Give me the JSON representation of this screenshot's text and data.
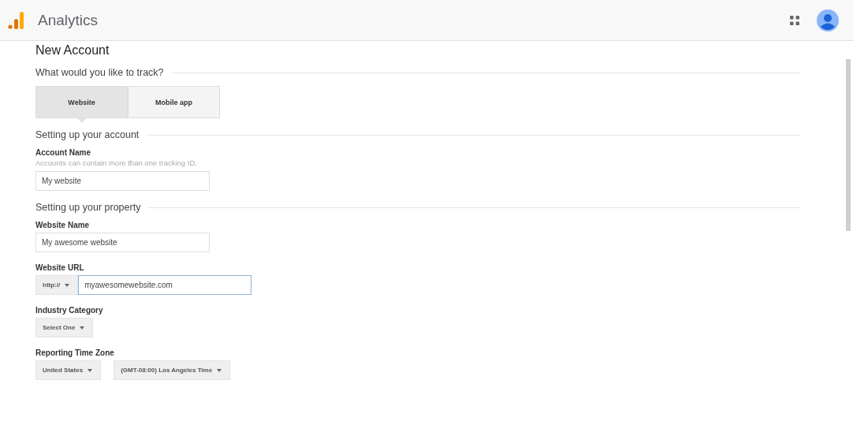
{
  "app": {
    "title": "Analytics"
  },
  "page_title": "New Account",
  "track": {
    "heading": "What would you like to track?",
    "options": [
      {
        "label": "Website",
        "selected": true
      },
      {
        "label": "Mobile app",
        "selected": false
      }
    ]
  },
  "sections": [
    {
      "heading": "Setting up your account",
      "fields": [
        {
          "kind": "text",
          "label": "Account Name",
          "hint": "Accounts can contain more than one tracking ID.",
          "value": "My website"
        }
      ]
    },
    {
      "heading": "Setting up your property",
      "fields": [
        {
          "kind": "text",
          "label": "Website Name",
          "value": "My awesome website"
        },
        {
          "kind": "url",
          "label": "Website URL",
          "protocol": "http://",
          "value": "myawesomewebsite.com",
          "focused": true
        },
        {
          "kind": "select",
          "label": "Industry Category",
          "dropdowns": [
            "Select One"
          ]
        },
        {
          "kind": "select",
          "label": "Reporting Time Zone",
          "dropdowns": [
            "United States",
            "(GMT-08:00) Los Angeles Time"
          ]
        }
      ]
    }
  ]
}
